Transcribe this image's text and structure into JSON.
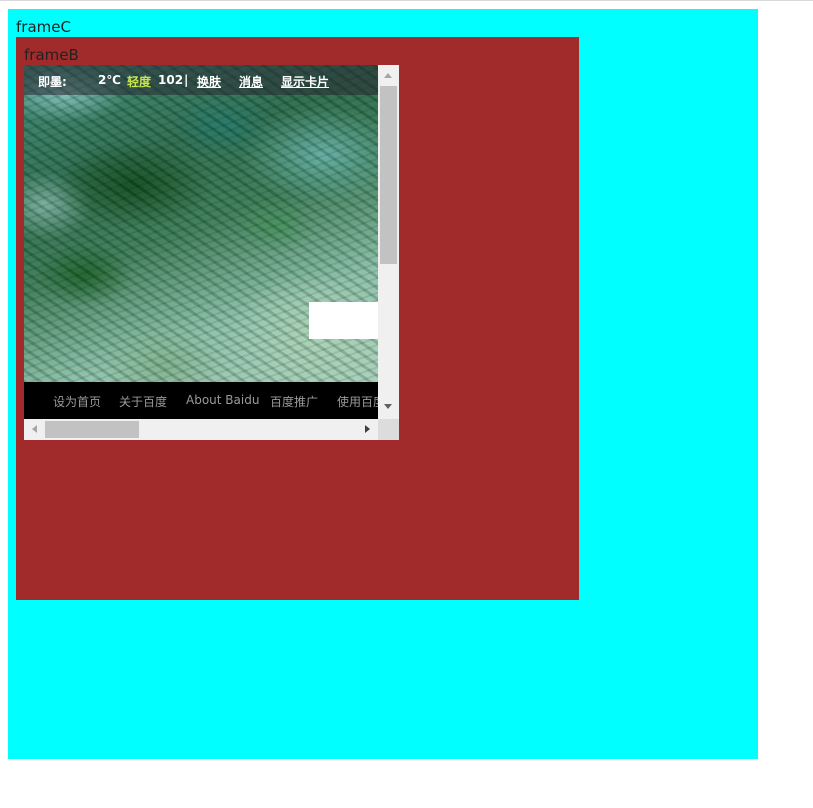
{
  "frame_c": {
    "label": "frameC",
    "background": "#00ffff"
  },
  "frame_b": {
    "label": "frameB",
    "background": "#a12b2b"
  },
  "baidu": {
    "top_bar": {
      "city": "即墨:",
      "temperature": "2℃",
      "air_quality_level": "轻度",
      "aqi_value": "102",
      "separator": "|",
      "skin_link": "换肤",
      "messages_link": "消息",
      "show_cards_link": "显示卡片"
    },
    "footer": {
      "links": [
        "设为首页",
        "关于百度",
        "About Baidu",
        "百度推广",
        "使用百度"
      ]
    }
  },
  "colors": {
    "air_quality": "#c8e54b",
    "footer_text": "#9a9a9a",
    "scroll_thumb": "#c2c2c2"
  },
  "icons": [
    "scroll-up-arrow-icon",
    "scroll-down-arrow-icon",
    "scroll-left-arrow-icon",
    "scroll-right-arrow-icon"
  ]
}
